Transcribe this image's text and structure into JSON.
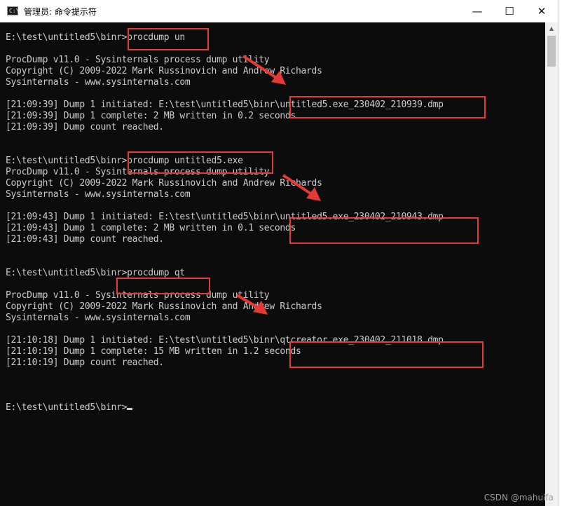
{
  "window": {
    "title": "管理员: 命令提示符",
    "icon_text": "C:\\",
    "controls": {
      "minimize": "—",
      "maximize": "☐",
      "close": "✕"
    }
  },
  "console": {
    "lines": [
      "E:\\test\\untitled5\\binr>procdump un",
      "",
      "ProcDump v11.0 - Sysinternals process dump utility",
      "Copyright (C) 2009-2022 Mark Russinovich and Andrew Richards",
      "Sysinternals - www.sysinternals.com",
      "",
      "[21:09:39] Dump 1 initiated: E:\\test\\untitled5\\binr\\untitled5.exe_230402_210939.dmp",
      "[21:09:39] Dump 1 complete: 2 MB written in 0.2 seconds",
      "[21:09:39] Dump count reached.",
      "",
      "",
      "E:\\test\\untitled5\\binr>procdump untitled5.exe",
      "ProcDump v11.0 - Sysinternals process dump utility",
      "Copyright (C) 2009-2022 Mark Russinovich and Andrew Richards",
      "Sysinternals - www.sysinternals.com",
      "",
      "[21:09:43] Dump 1 initiated: E:\\test\\untitled5\\binr\\untitled5.exe_230402_210943.dmp",
      "[21:09:43] Dump 1 complete: 2 MB written in 0.1 seconds",
      "[21:09:43] Dump count reached.",
      "",
      "",
      "E:\\test\\untitled5\\binr>procdump qt",
      "",
      "ProcDump v11.0 - Sysinternals process dump utility",
      "Copyright (C) 2009-2022 Mark Russinovich and Andrew Richards",
      "Sysinternals - www.sysinternals.com",
      "",
      "[21:10:18] Dump 1 initiated: E:\\test\\untitled5\\binr\\qtcreator.exe_230402_211018.dmp",
      "[21:10:19] Dump 1 complete: 15 MB written in 1.2 seconds",
      "[21:10:19] Dump count reached.",
      "",
      "",
      ""
    ],
    "prompt": "E:\\test\\untitled5\\binr>"
  },
  "watermark": "CSDN @mahuifa"
}
